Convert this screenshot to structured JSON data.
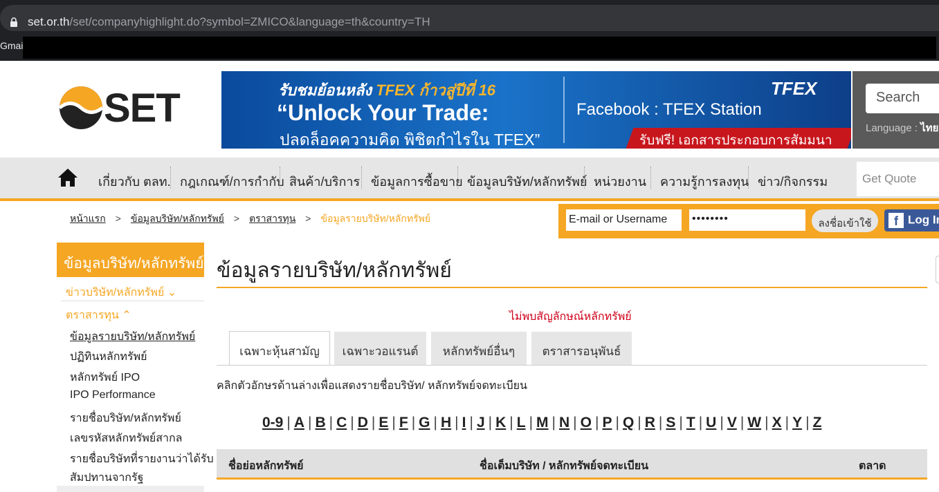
{
  "browser": {
    "url_host": "set.or.th",
    "url_path": "/set/companyhighlight.do?symbol=ZMICO&language=th&country=TH",
    "bookmark": "Gmail"
  },
  "header": {
    "logo_text": "SET",
    "banner": {
      "line1_prefix": "รับชมย้อนหลัง ",
      "line1_highlight": "TFEX ก้าวสู่ปีที่ 16",
      "line2": "“Unlock Your Trade:",
      "line3": "ปลดล็อคความคิด พิชิตกำไรใน TFEX”",
      "brand": "TFEX",
      "facebook": "Facebook : TFEX Station",
      "free": "รับฟรี! เอกสารประกอบการสัมมนา"
    },
    "search_placeholder": "Search",
    "language_label": "Language : ",
    "language_value": "ไทย"
  },
  "nav": {
    "items": [
      "เกี่ยวกับ ตลท.",
      "กฎเกณฑ์/การกำกับ",
      "สินค้า/บริการ",
      "ข้อมูลการซื้อขาย",
      "ข้อมูลบริษัท/หลักทรัพย์",
      "หน่วยงาน",
      "ความรู้การลงทุน",
      "ข่าว/กิจกรรม"
    ],
    "get_quote_placeholder": "Get Quote"
  },
  "breadcrumb": {
    "home": "หน้าแรก",
    "level1": "ข้อมูลบริษัท/หลักทรัพย์",
    "level2": "ตราสารทุน",
    "current": "ข้อมูลรายบริษัท/หลักทรัพย์",
    "separator": ">"
  },
  "login": {
    "email_placeholder": "E-mail or Username",
    "password_value": "••••••••",
    "login_button": "ลงชื่อเข้าใช้",
    "facebook_button": "Log In"
  },
  "sidebar": {
    "heading": "ข้อมูลบริษัท/หลักทรัพย์",
    "news_link": "ข่าวบริษัท/หลักทรัพย์ ⌄",
    "equity_link": "ตราสารทุน ⌃",
    "items": [
      "ข้อมูลรายบริษัท/หลักทรัพย์",
      "ปฏิทินหลักทรัพย์",
      "หลักทรัพย์ IPO",
      "IPO Performance",
      "รายชื่อบริษัท/หลักทรัพย์",
      "เลขรหัสหลักทรัพย์สากล",
      "รายชื่อบริษัทที่รายงานว่าได้รับ",
      "สัมปทานจากรัฐ"
    ]
  },
  "main": {
    "title": "ข้อมูลรายบริษัท/หลักทรัพย์",
    "not_found": "ไม่พบสัญลักษณ์หลักทรัพย์",
    "tabs": [
      "เฉพาะหุ้นสามัญ",
      "เฉพาะวอแรนต์",
      "หลักทรัพย์อื่นๆ",
      "ตราสารอนุพันธ์"
    ],
    "instruction": "คลิกตัวอักษรด้านล่างเพื่อแสดงรายชื่อบริษัท/ หลักทรัพย์จดทะเบียน",
    "letters": [
      "0-9",
      "A",
      "B",
      "C",
      "D",
      "E",
      "F",
      "G",
      "H",
      "I",
      "J",
      "K",
      "L",
      "M",
      "N",
      "O",
      "P",
      "Q",
      "R",
      "S",
      "T",
      "U",
      "V",
      "W",
      "X",
      "Y",
      "Z"
    ],
    "table_headers": [
      "ชื่อย่อหลักทรัพย์",
      "ชื่อเต็มบริษัท / หลักทรัพย์จดทะเบียน",
      "ตลาด"
    ]
  },
  "colors": {
    "accent": "#f5a623",
    "error": "#d0021b",
    "nav_bg": "#e6e6e6"
  }
}
